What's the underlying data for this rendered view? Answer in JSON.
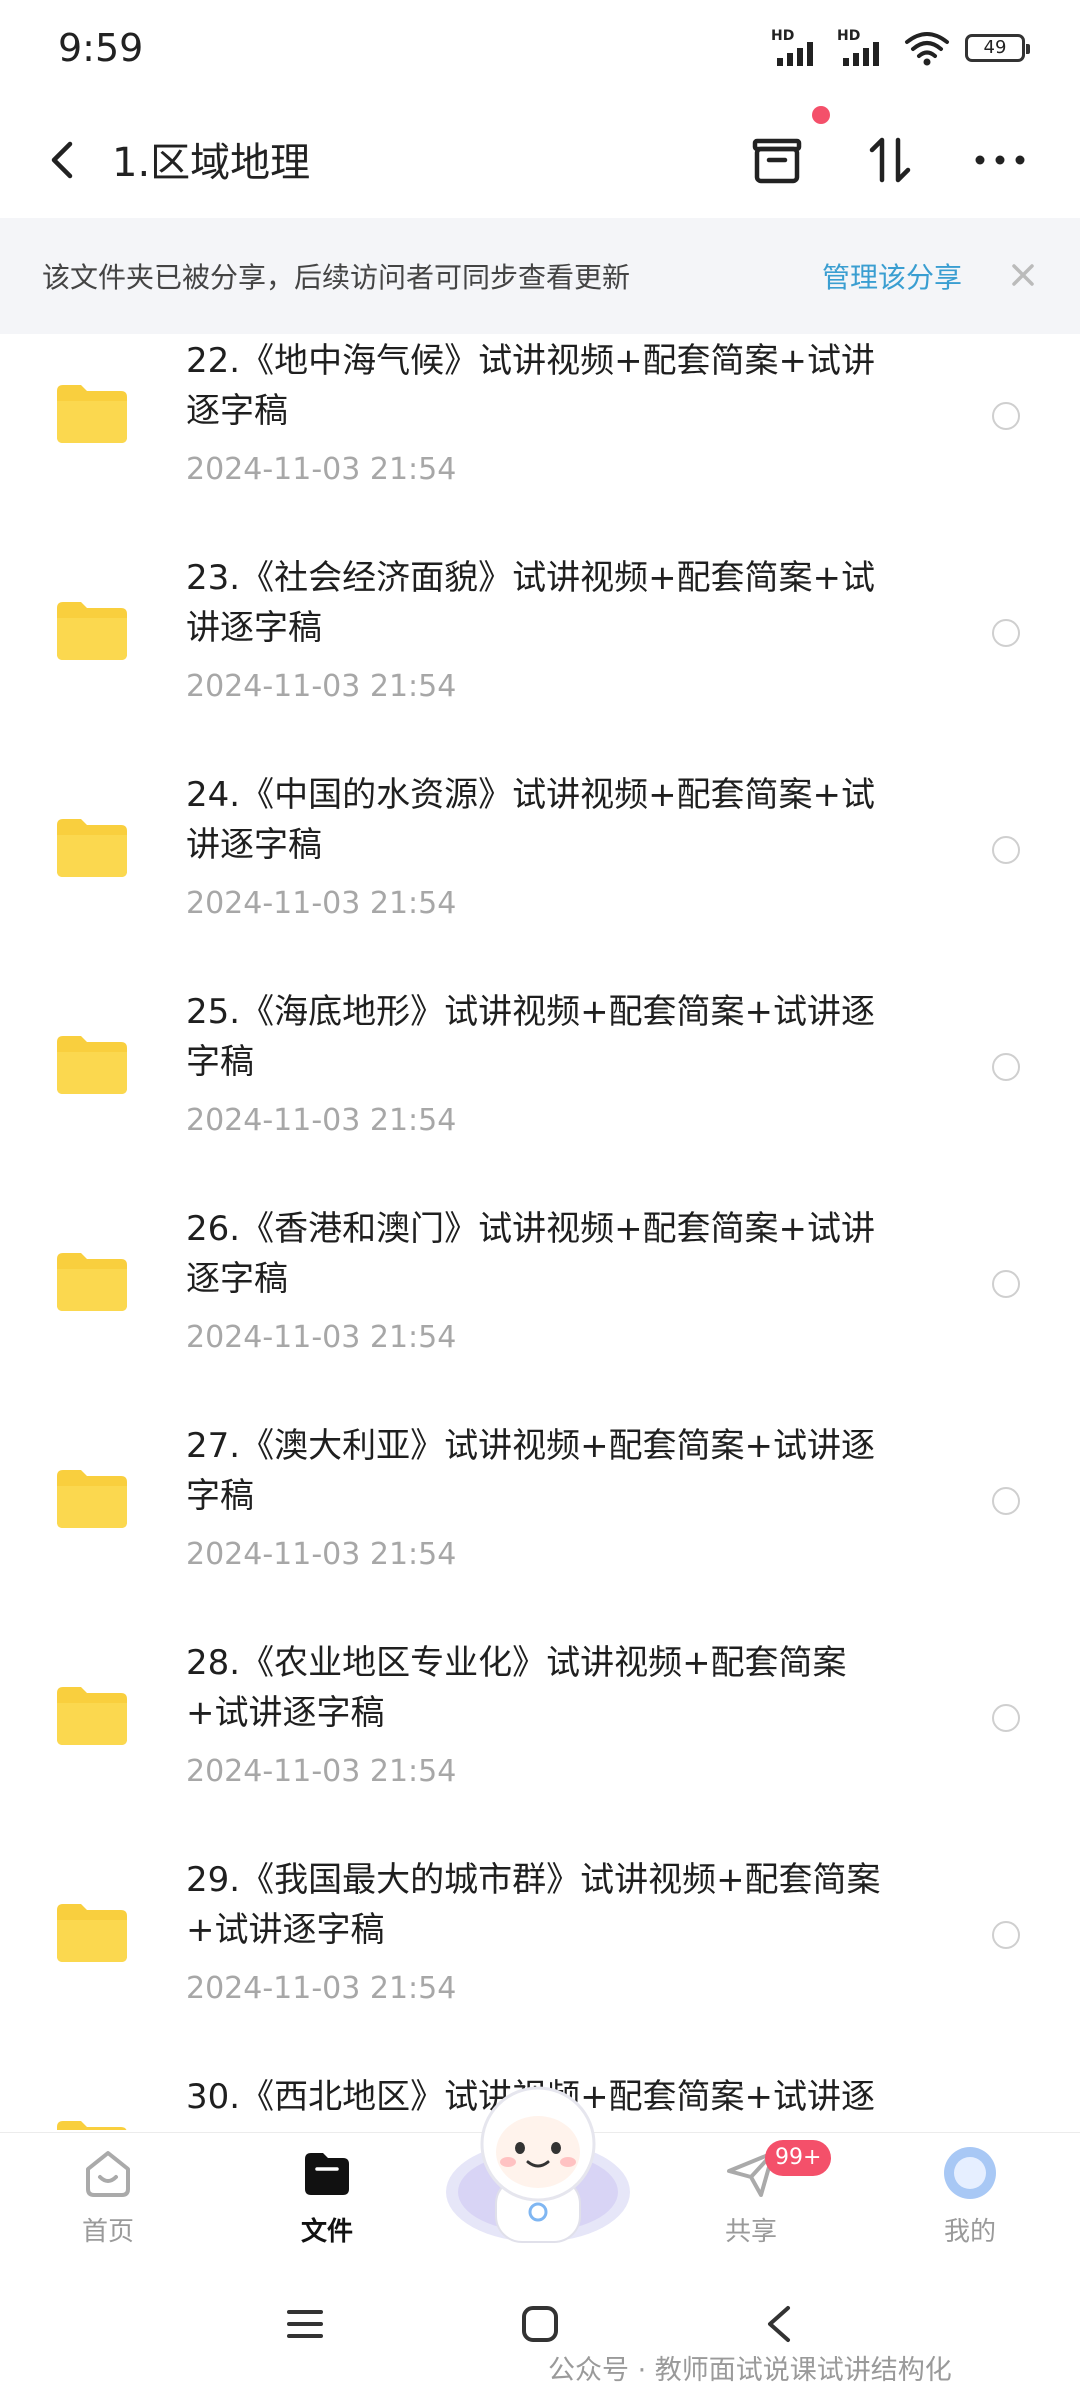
{
  "status": {
    "time": "9:59",
    "signal1": "HD",
    "signal2": "HD",
    "battery": "49"
  },
  "header": {
    "title": "1.区域地理",
    "icons": [
      "back-icon",
      "archive-icon",
      "sort-icon",
      "more-icon"
    ]
  },
  "notice": {
    "text": "该文件夹已被分享，后续访问者可同步查看更新",
    "link": "管理该分享"
  },
  "files": [
    {
      "line1": "22.《地中海气候》试讲视频+配套简案+试讲",
      "line2": "逐字稿",
      "date": "2024-11-03  21:54"
    },
    {
      "line1": "23.《社会经济面貌》试讲视频+配套简案+试",
      "line2": "讲逐字稿",
      "date": "2024-11-03  21:54"
    },
    {
      "line1": "24.《中国的水资源》试讲视频+配套简案+试",
      "line2": "讲逐字稿",
      "date": "2024-11-03  21:54"
    },
    {
      "line1": "25.《海底地形》试讲视频+配套简案+试讲逐",
      "line2": "字稿",
      "date": "2024-11-03  21:54"
    },
    {
      "line1": "26.《香港和澳门》试讲视频+配套简案+试讲",
      "line2": "逐字稿",
      "date": "2024-11-03  21:54"
    },
    {
      "line1": "27.《澳大利亚》试讲视频+配套简案+试讲逐",
      "line2": "字稿",
      "date": "2024-11-03  21:54"
    },
    {
      "line1": "28.《农业地区专业化》试讲视频+配套简案",
      "line2": "+试讲逐字稿",
      "date": "2024-11-03  21:54"
    },
    {
      "line1": "29.《我国最大的城市群》试讲视频+配套简案",
      "line2": "+试讲逐字稿",
      "date": "2024-11-03  21:54"
    },
    {
      "line1": "30.《西北地区》试讲视频+配套简案+试讲逐",
      "line2": "",
      "date": ""
    }
  ],
  "nav": {
    "home": "首页",
    "files": "文件",
    "share": "共享",
    "mine": "我的",
    "share_badge": "99+"
  },
  "watermark": "公众号 · 教师面试说课试讲结构化",
  "colors": {
    "accent_link": "#3a9ed1",
    "folder": "#f9cf3e",
    "badge": "#f4506a",
    "notice_bg": "#f4f5f8"
  }
}
